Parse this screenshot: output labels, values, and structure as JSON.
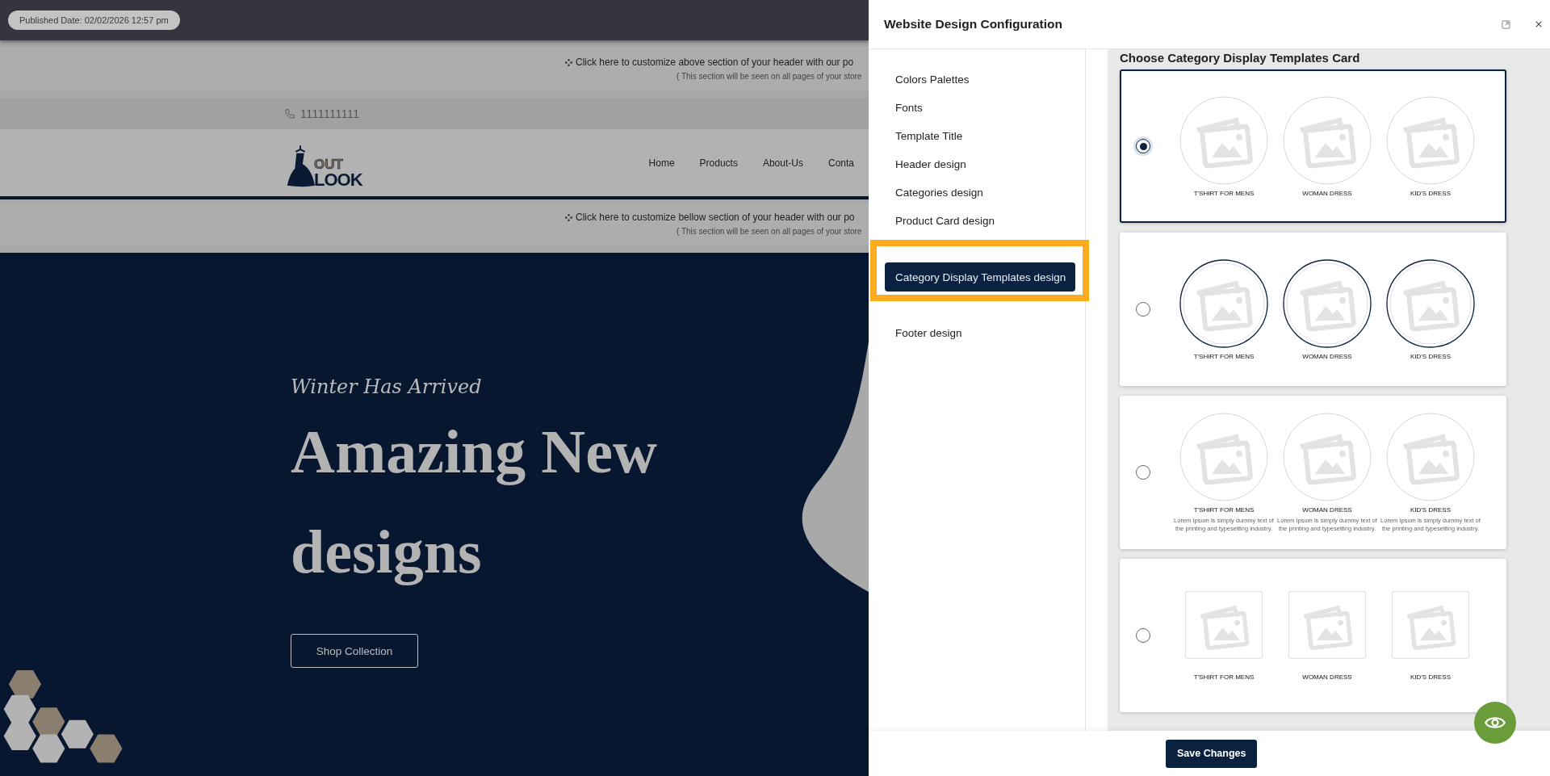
{
  "published_badge": "Published Date: 02/02/2026 12:57 pm",
  "store_preview": {
    "top_banner": {
      "text": "Click here to customize above section of your header with our po",
      "note": "( This section will be seen on all pages of your store"
    },
    "phone": "1111111111",
    "logo": {
      "top": "OUT",
      "bottom": "LOOK"
    },
    "nav": [
      "Home",
      "Products",
      "About-Us",
      "Conta"
    ],
    "bottom_banner": {
      "text": "Click here to customize bellow section of your header with our po",
      "note": "( This section will be seen on all pages of your store"
    },
    "hero": {
      "subtitle": "Winter Has Arrived",
      "title": "Amazing New designs",
      "button": "Shop Collection"
    }
  },
  "dialog": {
    "title": "Website Design Configuration",
    "menu": [
      {
        "label": "Colors Palettes",
        "selected": false
      },
      {
        "label": "Fonts",
        "selected": false
      },
      {
        "label": "Template Title",
        "selected": false
      },
      {
        "label": "Header design",
        "selected": false
      },
      {
        "label": "Categories design",
        "selected": false
      },
      {
        "label": "Product Card design",
        "selected": false
      },
      {
        "label": "Category Display Templates design",
        "selected": true
      },
      {
        "label": "Footer design",
        "selected": false
      }
    ],
    "section_title": "Choose Category Display Templates Card",
    "templates": [
      {
        "kind": "circle",
        "selected": true,
        "categories": [
          {
            "name": "T'SHIRT FOR MENS"
          },
          {
            "name": "WOMAN DRESS"
          },
          {
            "name": "KID'S DRESS"
          }
        ]
      },
      {
        "kind": "ringed-circle",
        "selected": false,
        "categories": [
          {
            "name": "T'SHIRT FOR MENS"
          },
          {
            "name": "WOMAN DRESS"
          },
          {
            "name": "KID'S DRESS"
          }
        ]
      },
      {
        "kind": "circle-with-text",
        "selected": false,
        "categories": [
          {
            "name": "T'SHIRT FOR MENS",
            "description": "Lorem Ipsum is simply dummy text of the printing and typesetting industry."
          },
          {
            "name": "WOMAN DRESS",
            "description": "Lorem Ipsum is simply dummy text of the printing and typesetting industry."
          },
          {
            "name": "KID'S DRESS",
            "description": "Lorem Ipsum is simply dummy text of the printing and typesetting industry."
          }
        ]
      },
      {
        "kind": "square",
        "selected": false,
        "categories": [
          {
            "name": "T'SHIRT FOR MENS"
          },
          {
            "name": "WOMAN DRESS"
          },
          {
            "name": "KID'S DRESS"
          }
        ]
      }
    ],
    "save_button": "Save Changes"
  }
}
